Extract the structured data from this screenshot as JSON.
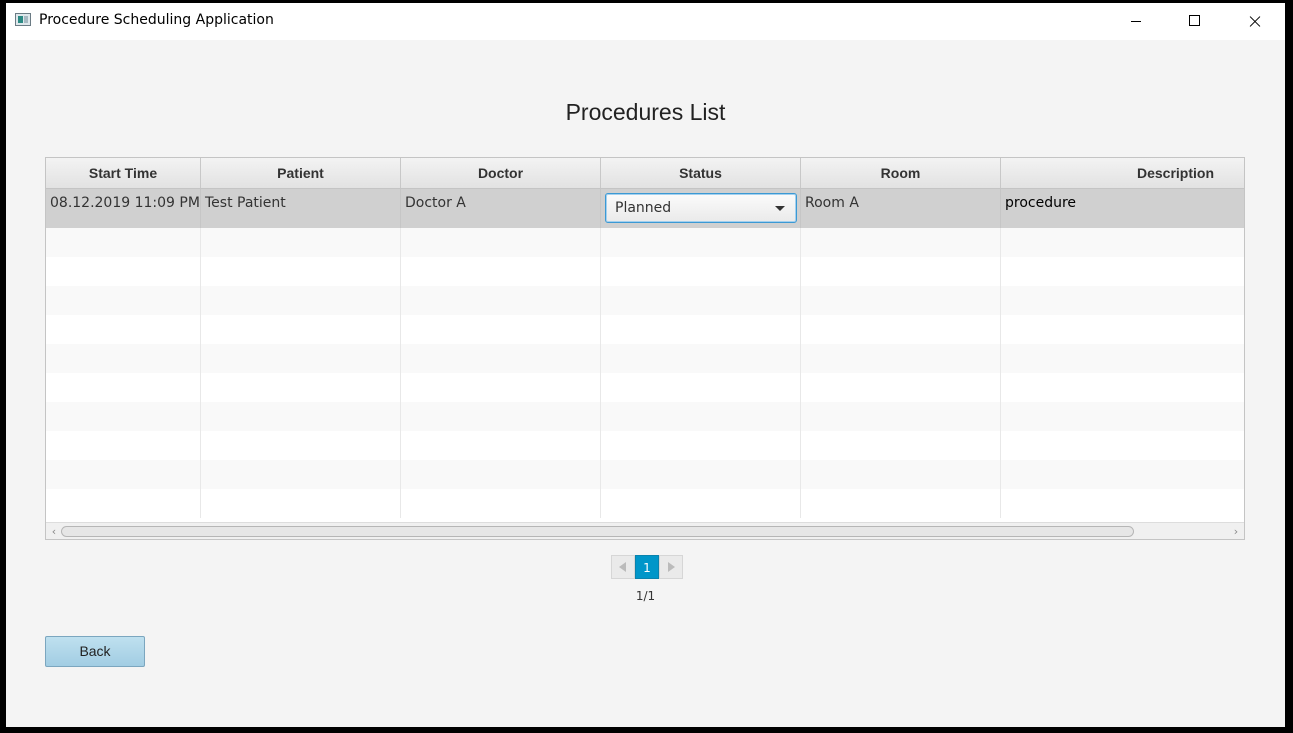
{
  "window": {
    "title": "Procedure Scheduling Application",
    "controls": {
      "minimize": "minimize-icon",
      "maximize": "maximize-icon",
      "close": "close-icon"
    }
  },
  "page": {
    "title": "Procedures List"
  },
  "table": {
    "columns": [
      "Start Time",
      "Patient",
      "Doctor",
      "Status",
      "Room",
      "Description"
    ],
    "rows": [
      {
        "start_time": "08.12.2019 11:09 PM",
        "patient": "Test Patient",
        "doctor": "Doctor A",
        "status": "Planned",
        "room": "Room A",
        "description": "procedure"
      }
    ],
    "empty_rows": 10
  },
  "pagination": {
    "current_page": "1",
    "label": "1/1"
  },
  "actions": {
    "back_label": "Back"
  },
  "colors": {
    "accent": "#0096c9",
    "selected_row": "#d0d0d0",
    "back_button": "#a2cde3"
  }
}
